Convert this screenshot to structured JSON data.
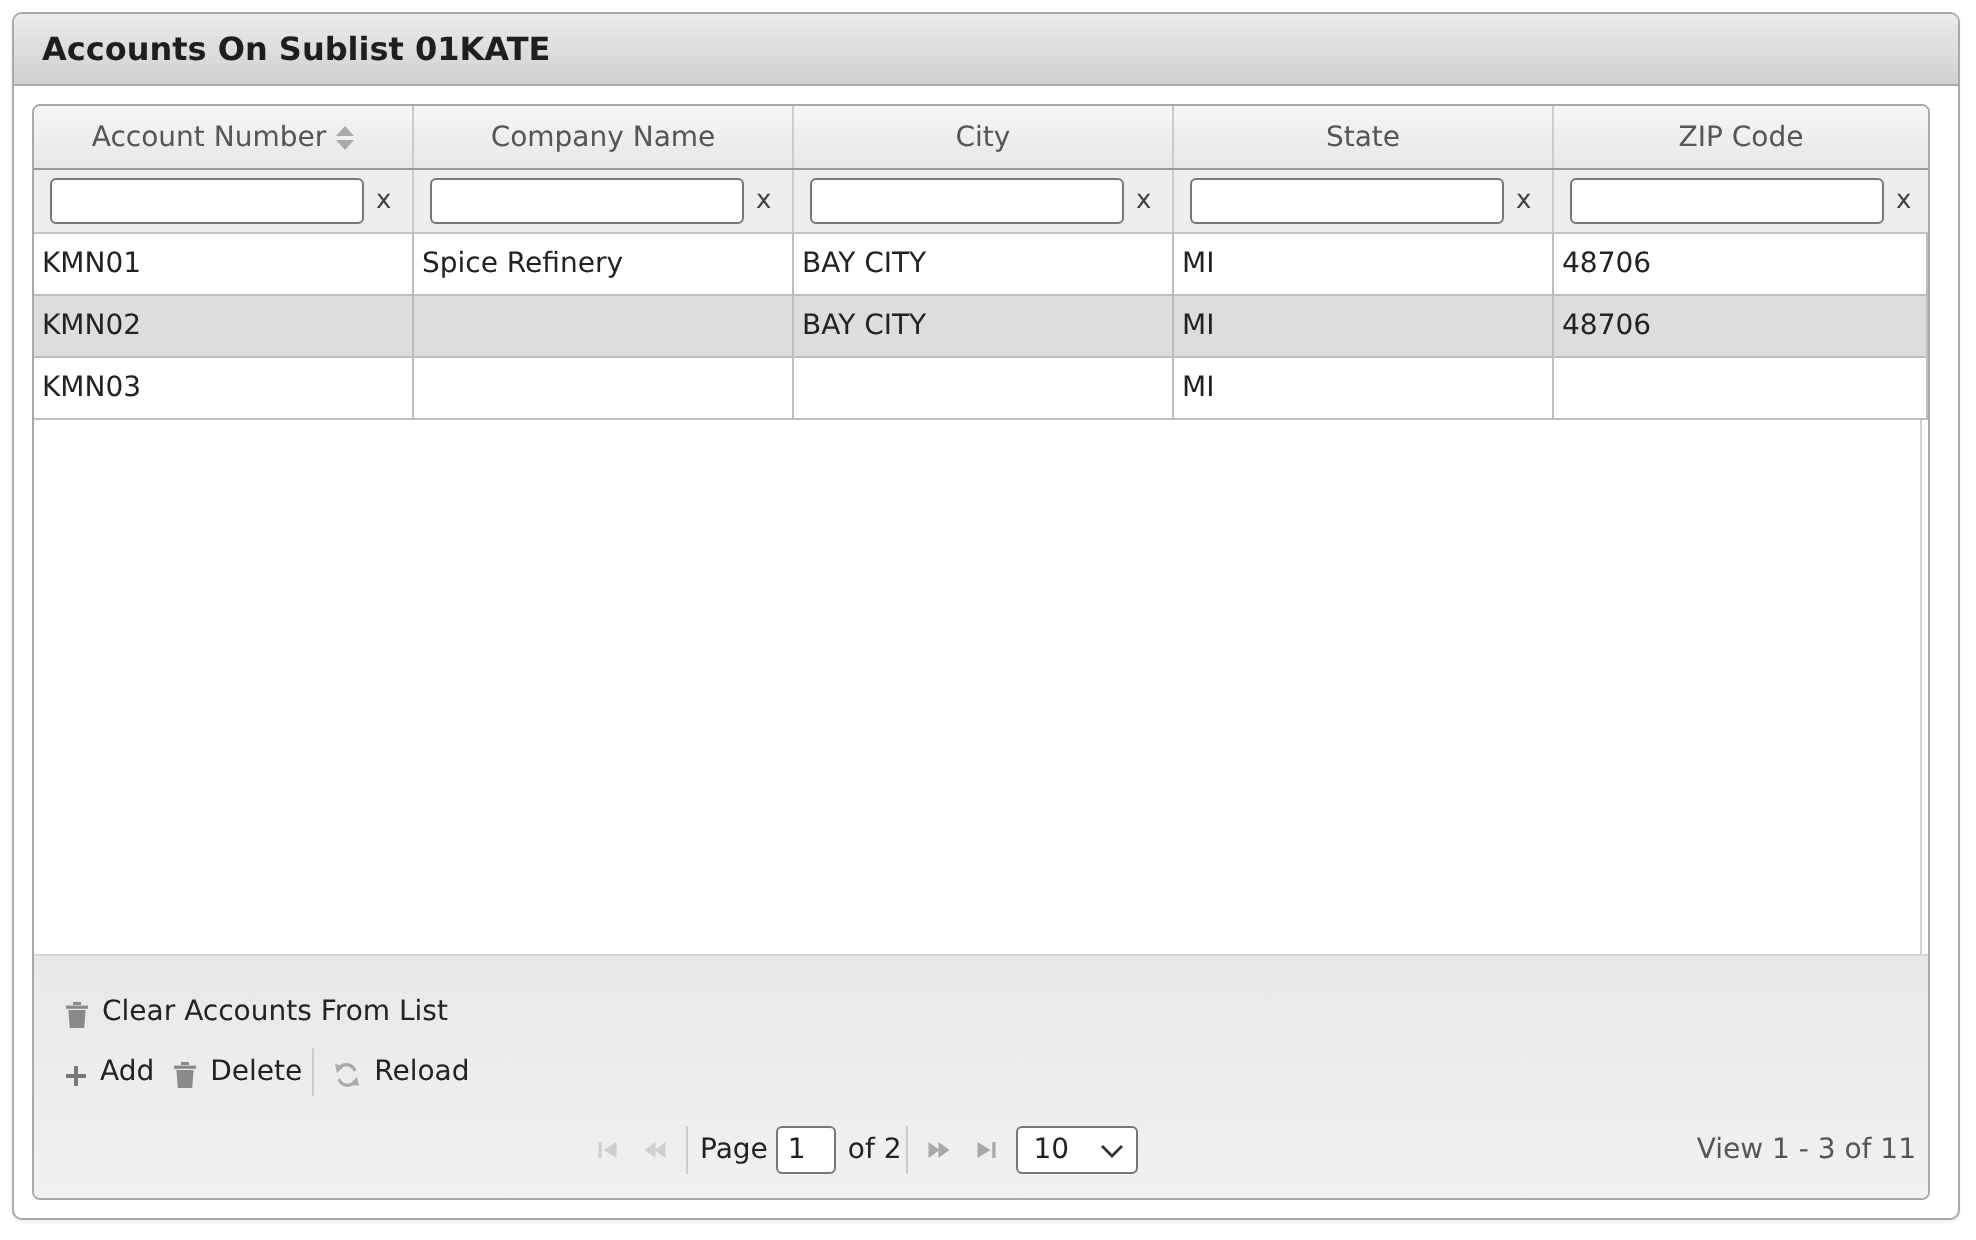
{
  "panel": {
    "title": "Accounts On Sublist 01KATE"
  },
  "table": {
    "columns": [
      {
        "label": "Account Number",
        "sortable": true,
        "clear": "x"
      },
      {
        "label": "Company Name",
        "sortable": false,
        "clear": "x"
      },
      {
        "label": "City",
        "sortable": false,
        "clear": "x"
      },
      {
        "label": "State",
        "sortable": false,
        "clear": "x"
      },
      {
        "label": "ZIP Code",
        "sortable": false,
        "clear": "x"
      }
    ],
    "rows": [
      {
        "selected": false,
        "cells": [
          "KMN01",
          "Spice Refinery",
          "BAY CITY",
          "MI",
          "48706"
        ]
      },
      {
        "selected": true,
        "cells": [
          "KMN02",
          null,
          "BAY CITY",
          "MI",
          "48706"
        ]
      },
      {
        "selected": false,
        "cells": [
          "KMN03",
          null,
          null,
          "MI",
          null
        ]
      }
    ]
  },
  "toolbar": {
    "rows": [
      [
        {
          "kind": "trash",
          "label": "Clear Accounts From List"
        }
      ],
      [
        {
          "kind": "plus",
          "label": "Add"
        },
        {
          "kind": "trash",
          "label": "Delete"
        },
        {
          "kind": "separator"
        },
        {
          "kind": "reload",
          "label": "Reload"
        }
      ]
    ]
  },
  "pager": {
    "nav_before": [
      {
        "kind": "first",
        "disabled": true
      },
      {
        "kind": "prev",
        "disabled": true
      }
    ],
    "page_label": "Page",
    "page": "1",
    "page_total": "of 2",
    "nav_after": [
      {
        "kind": "next",
        "disabled": false
      },
      {
        "kind": "last",
        "disabled": false
      }
    ],
    "page_size": "10",
    "record_info": "View 1 - 3 of 11"
  }
}
